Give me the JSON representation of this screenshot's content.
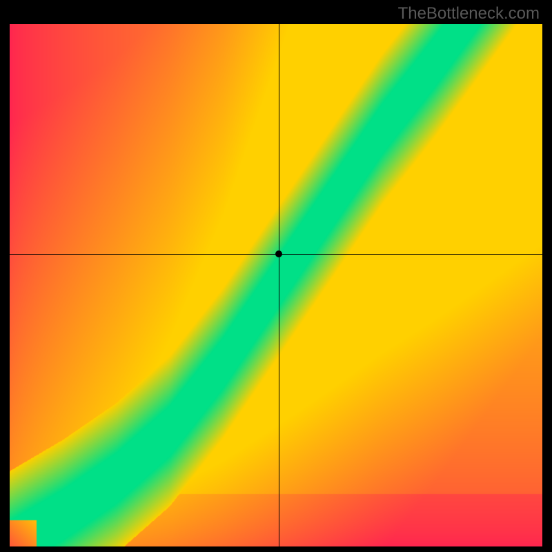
{
  "watermark": "TheBottleneck.com",
  "chart_data": {
    "type": "heatmap",
    "title": "",
    "xlabel": "",
    "ylabel": "",
    "x_range": [
      0,
      100
    ],
    "y_range": [
      0,
      100
    ],
    "crosshair": {
      "x": 50.5,
      "y": 56.0
    },
    "marker": {
      "x": 50.5,
      "y": 56.0
    },
    "colorscale": {
      "0": "#FF2550",
      "0.5": "#FFD000",
      "1": "#00E087"
    },
    "optimal_curve": [
      {
        "x": 0,
        "y": 0
      },
      {
        "x": 10,
        "y": 6
      },
      {
        "x": 20,
        "y": 13
      },
      {
        "x": 30,
        "y": 22
      },
      {
        "x": 40,
        "y": 35
      },
      {
        "x": 50,
        "y": 50
      },
      {
        "x": 60,
        "y": 65
      },
      {
        "x": 70,
        "y": 80
      },
      {
        "x": 80,
        "y": 93
      },
      {
        "x": 85,
        "y": 100
      }
    ],
    "band_width_normalized": 0.08
  }
}
